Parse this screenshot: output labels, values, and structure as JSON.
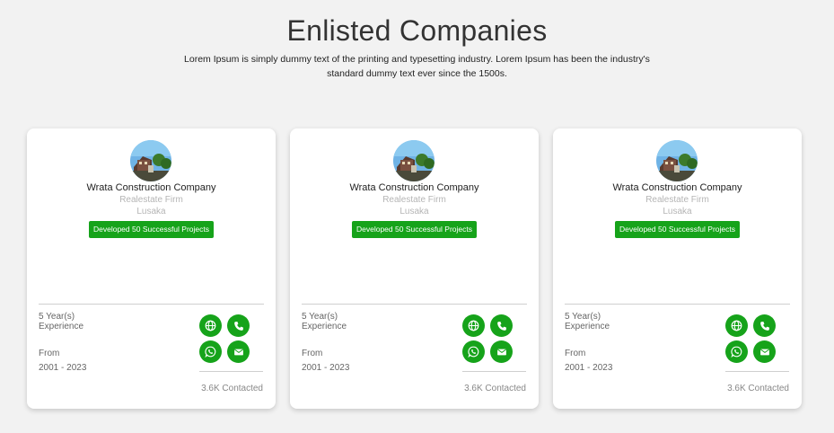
{
  "header": {
    "title": "Enlisted Companies",
    "subtitle": "Lorem Ipsum is simply dummy text of the printing and typesetting industry. Lorem Ipsum has been the industry's standard dummy text ever since the 1500s."
  },
  "colors": {
    "accent": "#16a31a",
    "background": "#f2f2f2"
  },
  "cards": [
    {
      "name": "Wrata Construction Company",
      "type": "Realestate Firm",
      "city": "Lusaka",
      "badge": "Developed 50 Successful Projects",
      "experience_years": "5 Year(s)",
      "experience_label": "Experience",
      "from_label": "From",
      "period": "2001 - 2023",
      "contacted": "3.6K Contacted",
      "icons": [
        "globe-icon",
        "phone-icon",
        "whatsapp-icon",
        "mail-icon"
      ]
    },
    {
      "name": "Wrata Construction Company",
      "type": "Realestate Firm",
      "city": "Lusaka",
      "badge": "Developed 50 Successful Projects",
      "experience_years": "5 Year(s)",
      "experience_label": "Experience",
      "from_label": "From",
      "period": "2001 - 2023",
      "contacted": "3.6K Contacted",
      "icons": [
        "globe-icon",
        "phone-icon",
        "whatsapp-icon",
        "mail-icon"
      ]
    },
    {
      "name": "Wrata Construction Company",
      "type": "Realestate Firm",
      "city": "Lusaka",
      "badge": "Developed 50 Successful Projects",
      "experience_years": "5 Year(s)",
      "experience_label": "Experience",
      "from_label": "From",
      "period": "2001 - 2023",
      "contacted": "3.6K Contacted",
      "icons": [
        "globe-icon",
        "phone-icon",
        "whatsapp-icon",
        "mail-icon"
      ]
    }
  ]
}
